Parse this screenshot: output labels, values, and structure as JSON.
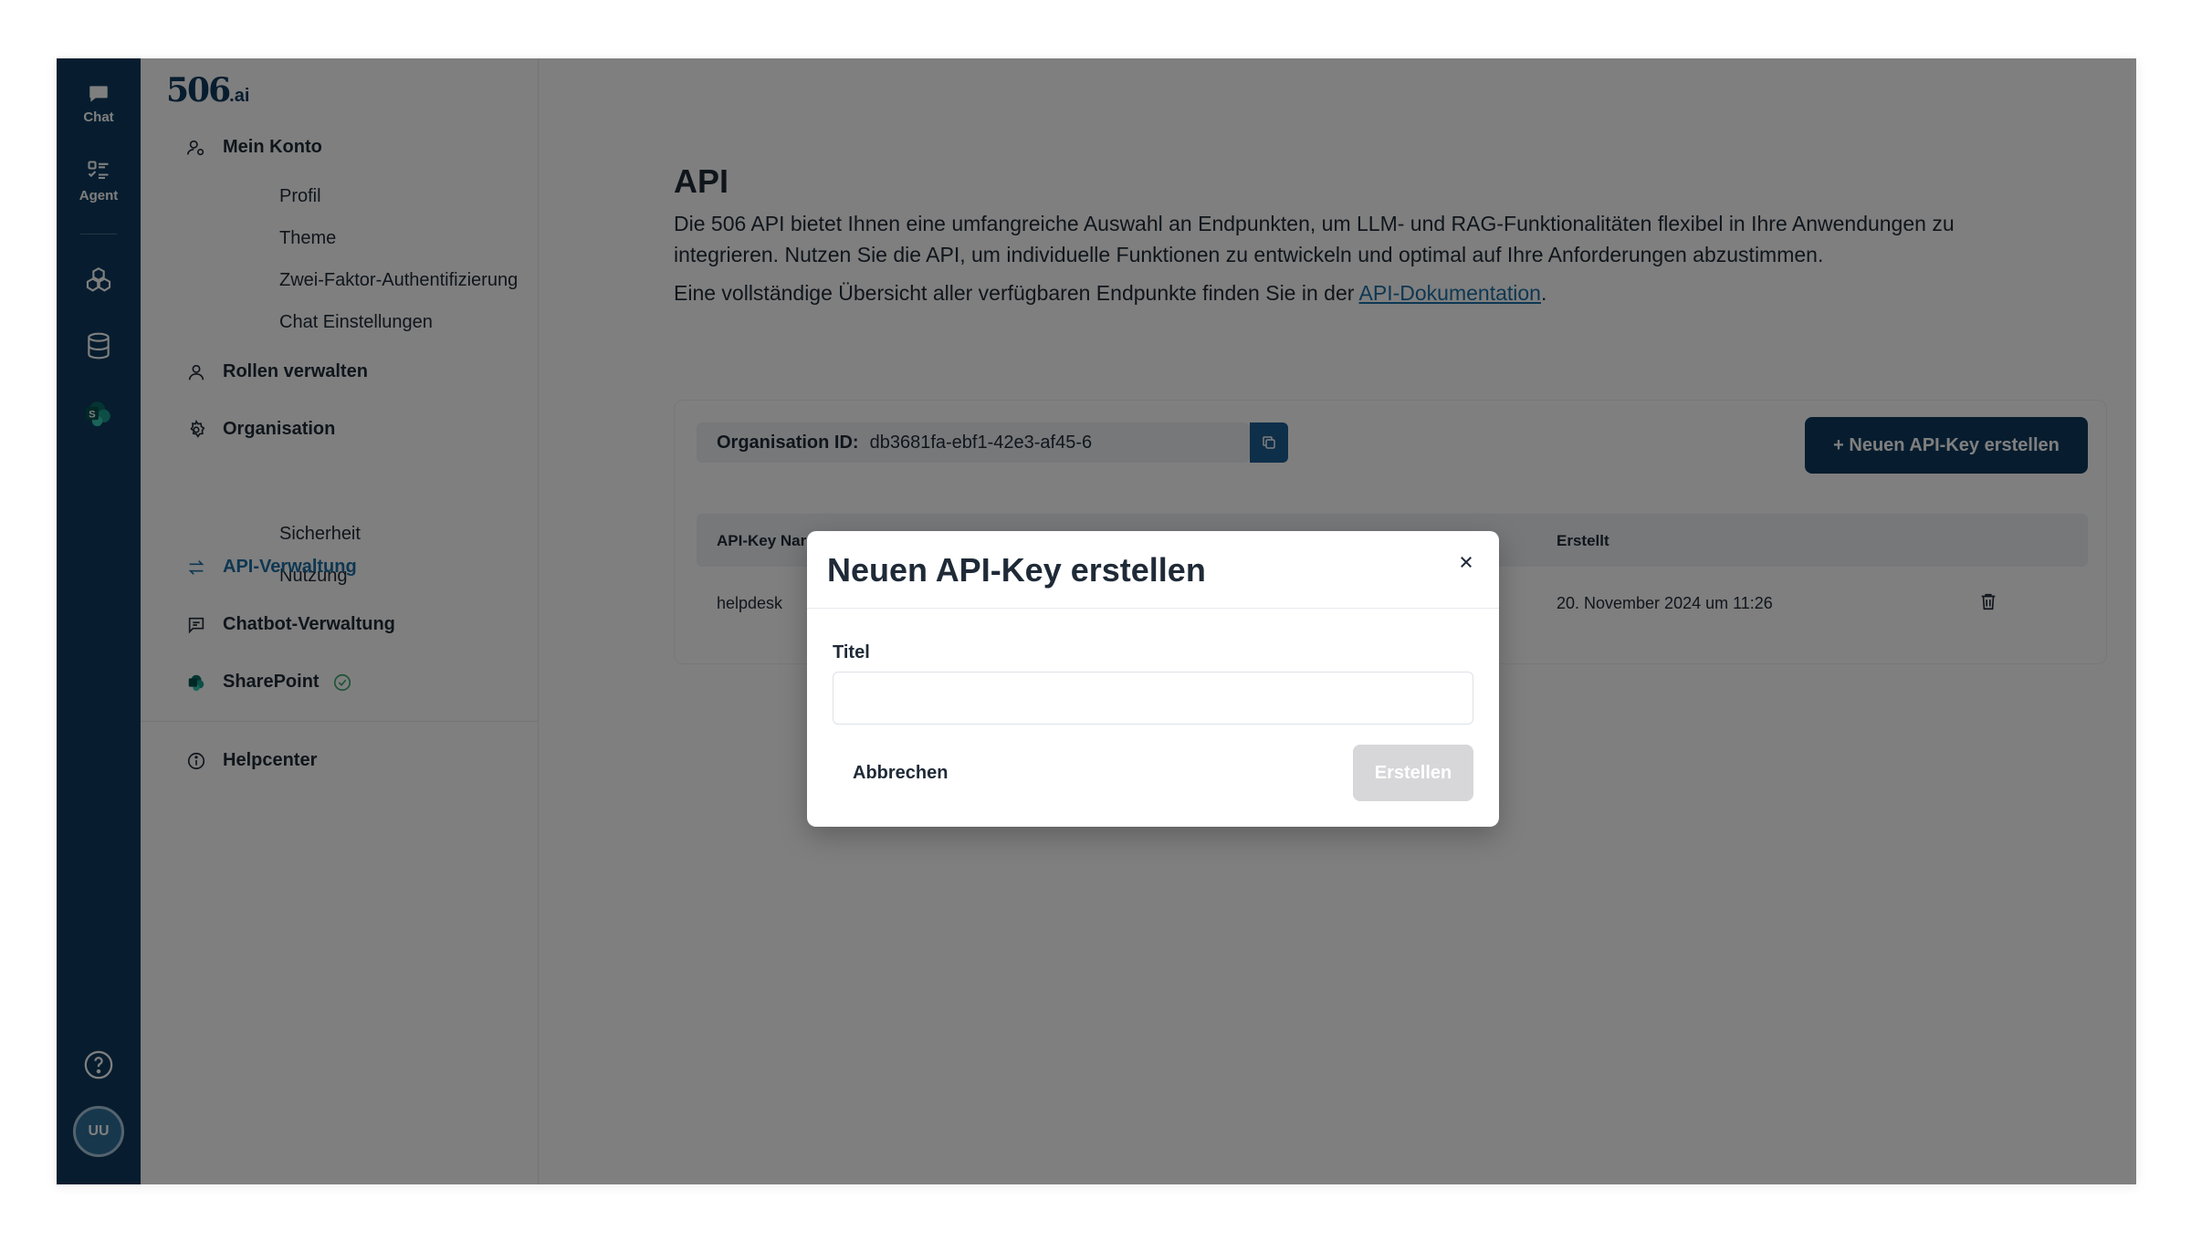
{
  "rail": {
    "chat_label": "Chat",
    "agent_label": "Agent",
    "avatar_initials": "UU"
  },
  "sidebar": {
    "logo_main": "506",
    "logo_suffix": ".ai",
    "mein_konto": "Mein Konto",
    "profil": "Profil",
    "theme": "Theme",
    "zwei_faktor": "Zwei-Faktor-Authentifizierung",
    "chat_einstellungen": "Chat Einstellungen",
    "rollen": "Rollen verwalten",
    "organisation": "Organisation",
    "sicherheit": "Sicherheit",
    "nutzung": "Nutzung",
    "api_verwaltung": "API-Verwaltung",
    "chatbot_verwaltung": "Chatbot-Verwaltung",
    "sharepoint": "SharePoint",
    "helpcenter": "Helpcenter"
  },
  "main": {
    "title": "API",
    "description": "Die 506 API bietet Ihnen eine umfangreiche Auswahl an Endpunkten, um LLM- und RAG-Funktionalitäten flexibel in Ihre Anwendungen zu integrieren. Nutzen Sie die API, um individuelle Funktionen zu entwickeln und optimal auf Ihre Anforderungen abzustimmen.",
    "overview_prefix": "Eine vollständige Übersicht aller verfügbaren Endpunkte finden Sie in der ",
    "overview_link": "API-Dokumentation",
    "overview_suffix": ".",
    "org_label": "Organisation ID:",
    "org_value": "db3681fa-ebf1-42e3-af45-6",
    "new_key_button": "+ Neuen API-Key erstellen",
    "table": {
      "col_name": "API-Key Nar",
      "col_created": "Erstellt",
      "rows": [
        {
          "name": "helpdesk",
          "created": "20. November 2024 um 11:26"
        }
      ]
    }
  },
  "modal": {
    "title": "Neuen API-Key erstellen",
    "field_label": "Titel",
    "field_value": "",
    "cancel_label": "Abbrechen",
    "create_label": "Erstellen"
  },
  "colors": {
    "rail_bg": "#0e3a5e",
    "accent": "#1d6fa5",
    "primary_button": "#0e3a5e",
    "disabled_button": "#d7d7d9"
  }
}
